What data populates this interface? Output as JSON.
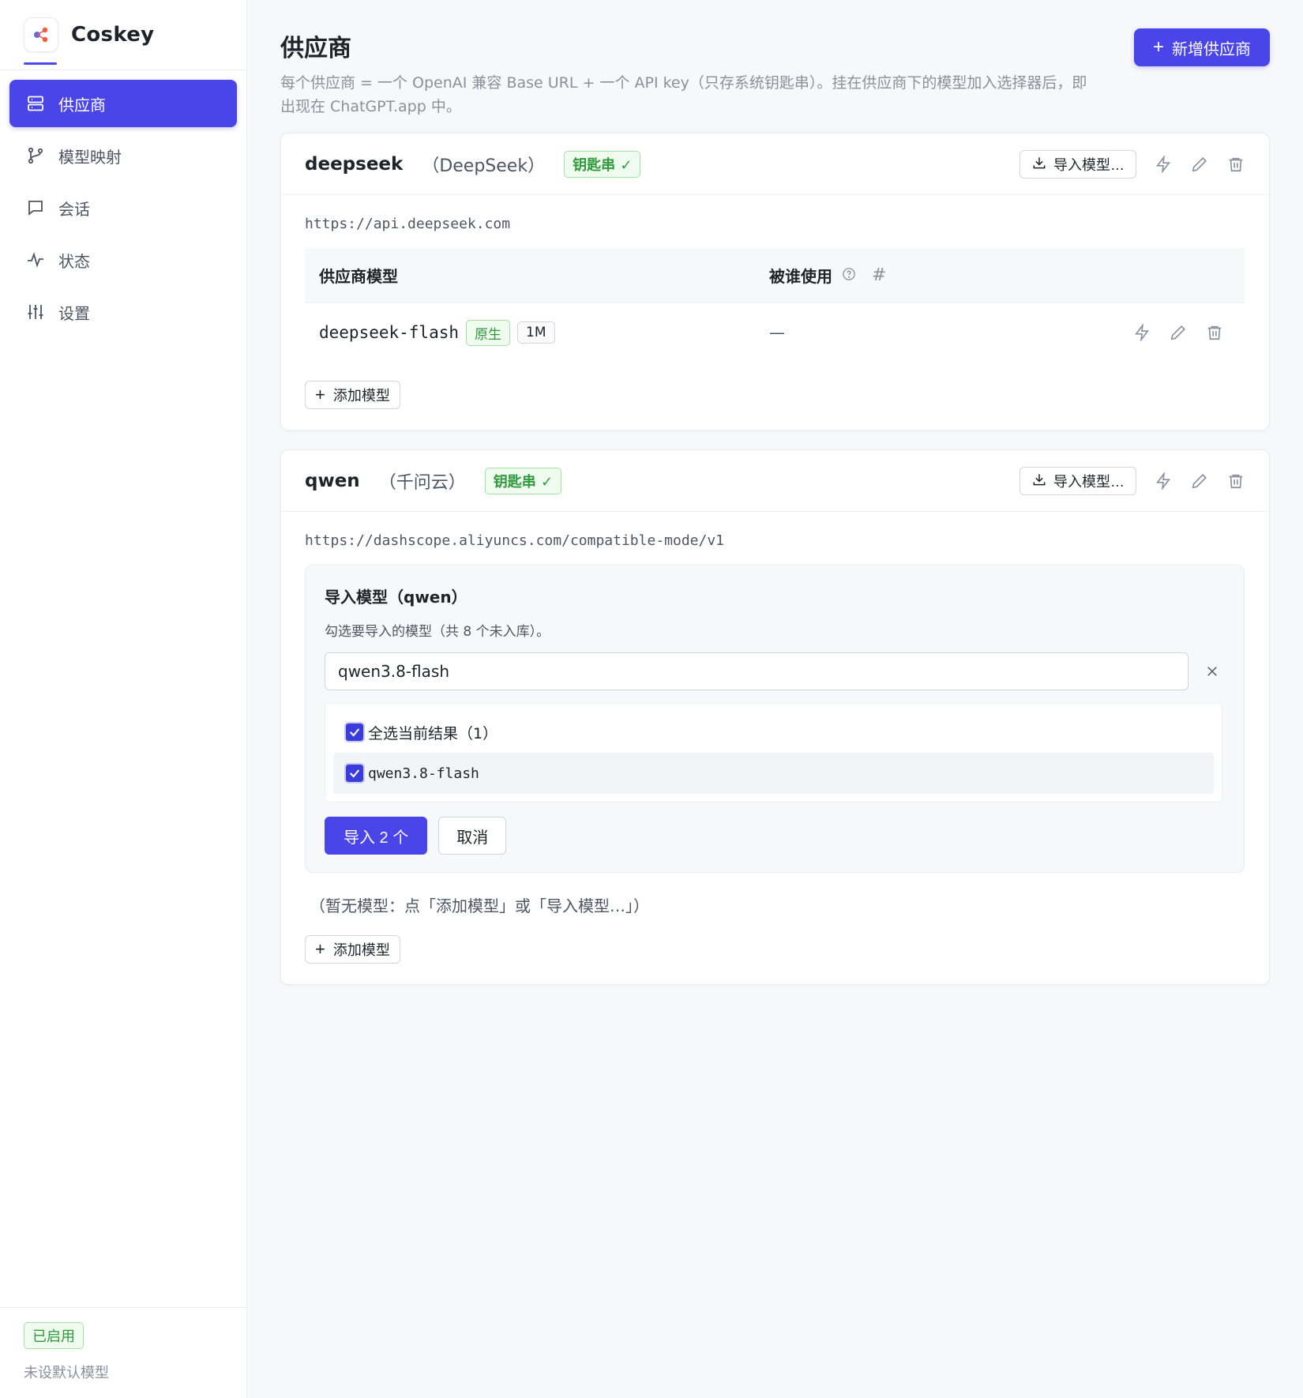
{
  "app": {
    "name": "Coskey"
  },
  "sidebar": {
    "items": [
      {
        "label": "供应商",
        "icon": "server-icon",
        "active": true
      },
      {
        "label": "模型映射",
        "icon": "git-branch-icon",
        "active": false
      },
      {
        "label": "会话",
        "icon": "chat-icon",
        "active": false
      },
      {
        "label": "状态",
        "icon": "activity-icon",
        "active": false
      },
      {
        "label": "设置",
        "icon": "sliders-icon",
        "active": false
      }
    ],
    "footer": {
      "status": "已启用",
      "default_model": "未设默认模型"
    }
  },
  "page": {
    "title": "供应商",
    "description": "每个供应商 = 一个 OpenAI 兼容 Base URL + 一个 API key（只存系统钥匙串）。挂在供应商下的模型加入选择器后，即出现在 ChatGPT.app 中。",
    "add_provider_label": "新增供应商"
  },
  "providers": [
    {
      "id": "deepseek",
      "alias": "（DeepSeek）",
      "key_badge": "钥匙串 ✓",
      "import_label": "导入模型…",
      "base_url": "https://api.deepseek.com",
      "table": {
        "col_model": "供应商模型",
        "col_used_by": "被谁使用",
        "col_hash": "#"
      },
      "models": [
        {
          "name": "deepseek-flash",
          "tag": "原生",
          "context": "1M",
          "used_by": "—"
        }
      ],
      "add_model_label": "添加模型"
    },
    {
      "id": "qwen",
      "alias": "（千问云）",
      "key_badge": "钥匙串 ✓",
      "import_label": "导入模型…",
      "base_url": "https://dashscope.aliyuncs.com/compatible-mode/v1",
      "import_panel": {
        "title": "导入模型（qwen）",
        "subtitle": "勾选要导入的模型（共 8 个未入库）。",
        "search_value": "qwen3.8-flash",
        "select_all_label": "全选当前结果（1）",
        "results": [
          "qwen3.8-flash"
        ],
        "import_button": "导入 2 个",
        "cancel_button": "取消"
      },
      "empty_hint": "（暂无模型：点「添加模型」或「导入模型…」）",
      "add_model_label": "添加模型"
    }
  ],
  "colors": {
    "primary": "#4a45e8",
    "success": "#2e9a3c",
    "muted": "#8a909c"
  }
}
